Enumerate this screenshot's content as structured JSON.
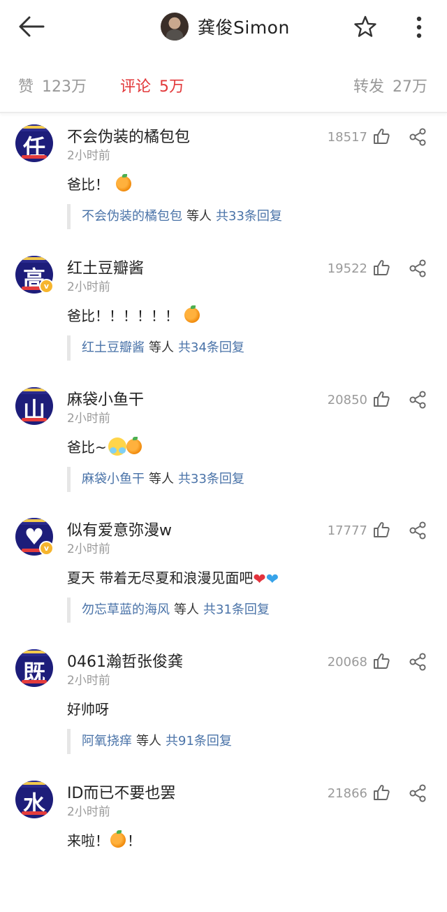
{
  "header": {
    "title": "龚俊Simon",
    "back_icon": "back-arrow-icon",
    "star_icon": "star-icon",
    "more_icon": "more-vertical-icon"
  },
  "stats": [
    {
      "label": "赞",
      "value": "123万",
      "active": false
    },
    {
      "label": "评论",
      "value": "5万",
      "active": true
    },
    {
      "label": "转发",
      "value": "27万",
      "active": false
    }
  ],
  "colors": {
    "accent": "#e2383a",
    "link": "#4a73a8",
    "muted": "#9a9a9a"
  },
  "comments": [
    {
      "avatar_glyph": "任",
      "verified": false,
      "name": "不会伪装的橘包包",
      "time": "2小时前",
      "text": "爸比！",
      "likes": "18517",
      "reply_user": "不会伪装的橘包包",
      "reply_etc": "等人",
      "reply_count": "共33条回复"
    },
    {
      "avatar_glyph": "高",
      "verified": true,
      "name": "红土豆瓣酱",
      "time": "2小时前",
      "text": "爸比！！！！！！",
      "likes": "19522",
      "reply_user": "红土豆瓣酱",
      "reply_etc": "等人",
      "reply_count": "共34条回复"
    },
    {
      "avatar_glyph": "山",
      "verified": false,
      "name": "麻袋小鱼干",
      "time": "2小时前",
      "text": "爸比~",
      "likes": "20850",
      "reply_user": "麻袋小鱼干",
      "reply_etc": "等人",
      "reply_count": "共33条回复"
    },
    {
      "avatar_glyph": "♥",
      "verified": true,
      "name": "似有爱意弥漫w",
      "time": "2小时前",
      "text": "夏天 带着无尽夏和浪漫见面吧",
      "likes": "17777",
      "reply_user": "勿忘草蓝的海风",
      "reply_etc": "等人",
      "reply_count": "共31条回复"
    },
    {
      "avatar_glyph": "既",
      "verified": false,
      "name": "0461瀚哲张俊龚",
      "time": "2小时前",
      "text": "好帅呀",
      "likes": "20068",
      "reply_user": "阿氧挠痒",
      "reply_etc": "等人",
      "reply_count": "共91条回复"
    },
    {
      "avatar_glyph": "水",
      "verified": false,
      "name": "ID而已不要也罢",
      "time": "2小时前",
      "text": "来啦！",
      "text_tail": "！",
      "likes": "21866"
    }
  ]
}
